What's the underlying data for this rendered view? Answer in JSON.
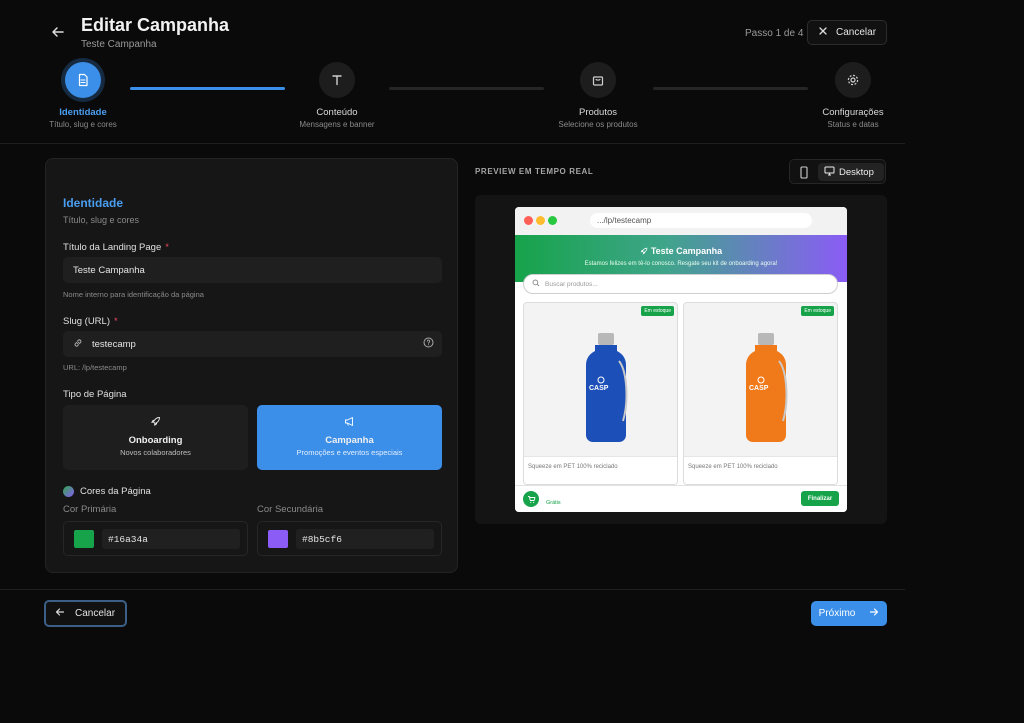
{
  "header": {
    "title": "Editar Campanha",
    "subtitle": "Teste Campanha",
    "step_indicator": "Passo 1 de 4",
    "cancel_label": "Cancelar"
  },
  "steps": [
    {
      "label": "Identidade",
      "sub": "Título, slug e cores",
      "icon": "document-icon",
      "active": true
    },
    {
      "label": "Conteúdo",
      "sub": "Mensagens e banner",
      "icon": "text-icon",
      "active": false
    },
    {
      "label": "Produtos",
      "sub": "Selecione os produtos",
      "icon": "bag-icon",
      "active": false
    },
    {
      "label": "Configurações",
      "sub": "Status e datas",
      "icon": "gear-icon",
      "active": false
    }
  ],
  "form": {
    "section_title": "Identidade",
    "section_sub": "Título, slug e cores",
    "title_label": "Título da Landing Page",
    "title_value": "Teste Campanha",
    "title_hint": "Nome interno para identificação da página",
    "slug_label": "Slug (URL)",
    "slug_value": "testecamp",
    "slug_hint": "URL: /lp/testecamp",
    "required_mark": "*",
    "type_label": "Tipo de Página",
    "types": [
      {
        "title": "Onboarding",
        "sub": "Novos colaboradores",
        "selected": false
      },
      {
        "title": "Campanha",
        "sub": "Promoções e eventos especiais",
        "selected": true
      }
    ],
    "colors_label": "Cores da Página",
    "primary_label": "Cor Primária",
    "primary_value": "#16a34a",
    "secondary_label": "Cor Secundária",
    "secondary_value": "#8b5cf6"
  },
  "preview": {
    "label": "PREVIEW EM TEMPO REAL",
    "device_desktop": "Desktop",
    "url": ".../lp/testecamp",
    "hero_title": "Teste Campanha",
    "hero_sub": "Estamos felizes em tê-lo conosco. Resgate seu kit de onboarding agora!",
    "search_placeholder": "Buscar produtos...",
    "products": [
      {
        "badge": "Em estoque",
        "caption": "Squeeze em PET 100% reciclado",
        "color": "#1d4fb8"
      },
      {
        "badge": "Em estoque",
        "caption": "Squeeze em PET 100% reciclado",
        "color": "#f07a1a"
      }
    ],
    "bottle_logo": "CASP",
    "free_label": "Grátis",
    "finalize_label": "Finalizar"
  },
  "footer": {
    "cancel_label": "Cancelar",
    "next_label": "Próximo"
  },
  "colors": {
    "accent": "#3b8fe8",
    "primary": "#16a34a",
    "secondary": "#8b5cf6"
  }
}
